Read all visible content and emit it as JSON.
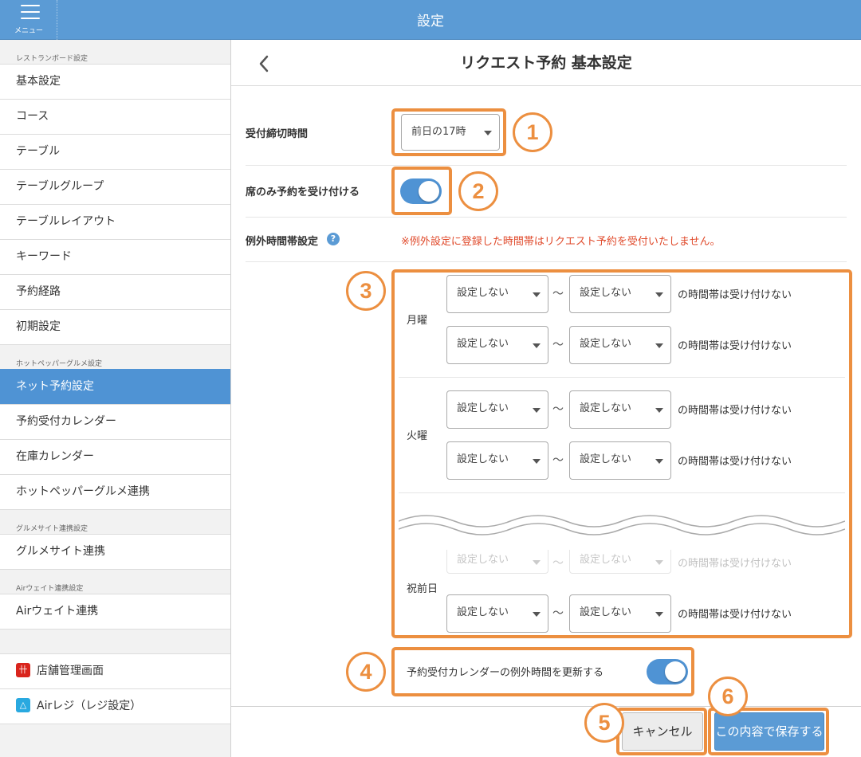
{
  "header": {
    "title": "設定",
    "menu_label": "メニュー"
  },
  "sidebar": {
    "sections": [
      {
        "heading": "レストランボード設定",
        "items": [
          "基本設定",
          "コース",
          "テーブル",
          "テーブルグループ",
          "テーブルレイアウト",
          "キーワード",
          "予約経路",
          "初期設定"
        ]
      },
      {
        "heading": "ホットペッパーグルメ設定",
        "items": [
          "ネット予約設定",
          "予約受付カレンダー",
          "在庫カレンダー",
          "ホットペッパーグルメ連携"
        ]
      },
      {
        "heading": "グルメサイト連携設定",
        "items": [
          "グルメサイト連携"
        ]
      },
      {
        "heading": "Airウェイト連携設定",
        "items": [
          "Airウェイト連携"
        ]
      }
    ],
    "active_item": "ネット予約設定",
    "external_links": [
      {
        "label": "店舗管理画面",
        "icon": "store-icon",
        "color": "#d9251d"
      },
      {
        "label": "Airレジ（レジ設定）",
        "icon": "airregi-icon",
        "color": "#29a9e0"
      }
    ]
  },
  "main": {
    "title": "リクエスト予約 基本設定",
    "deadline": {
      "label": "受付締切時間",
      "value": "前日の17時"
    },
    "seat_only": {
      "label": "席のみ予約を受け付ける",
      "enabled": true
    },
    "exceptions": {
      "label": "例外時間帯設定",
      "help": "?",
      "warning": "※例外設定に登録した時間帯はリクエスト予約を受付いたしません。",
      "select_default": "設定しない",
      "tilde": "〜",
      "phrase": "の時間帯は受け付けない",
      "days": [
        {
          "name": "月曜",
          "rows": 2
        },
        {
          "name": "火曜",
          "rows": 2
        },
        {
          "name": "祝前日",
          "rows": 2
        }
      ]
    },
    "update_calendar": {
      "label": "予約受付カレンダーの例外時間を更新する",
      "enabled": true
    },
    "buttons": {
      "cancel": "キャンセル",
      "save": "この内容で保存する"
    }
  },
  "annotations": [
    "1",
    "2",
    "3",
    "4",
    "5",
    "6"
  ],
  "colors": {
    "header": "#5b9bd5",
    "active": "#4f93d4",
    "highlight": "#ec8f40",
    "warning": "#e04a2b"
  }
}
